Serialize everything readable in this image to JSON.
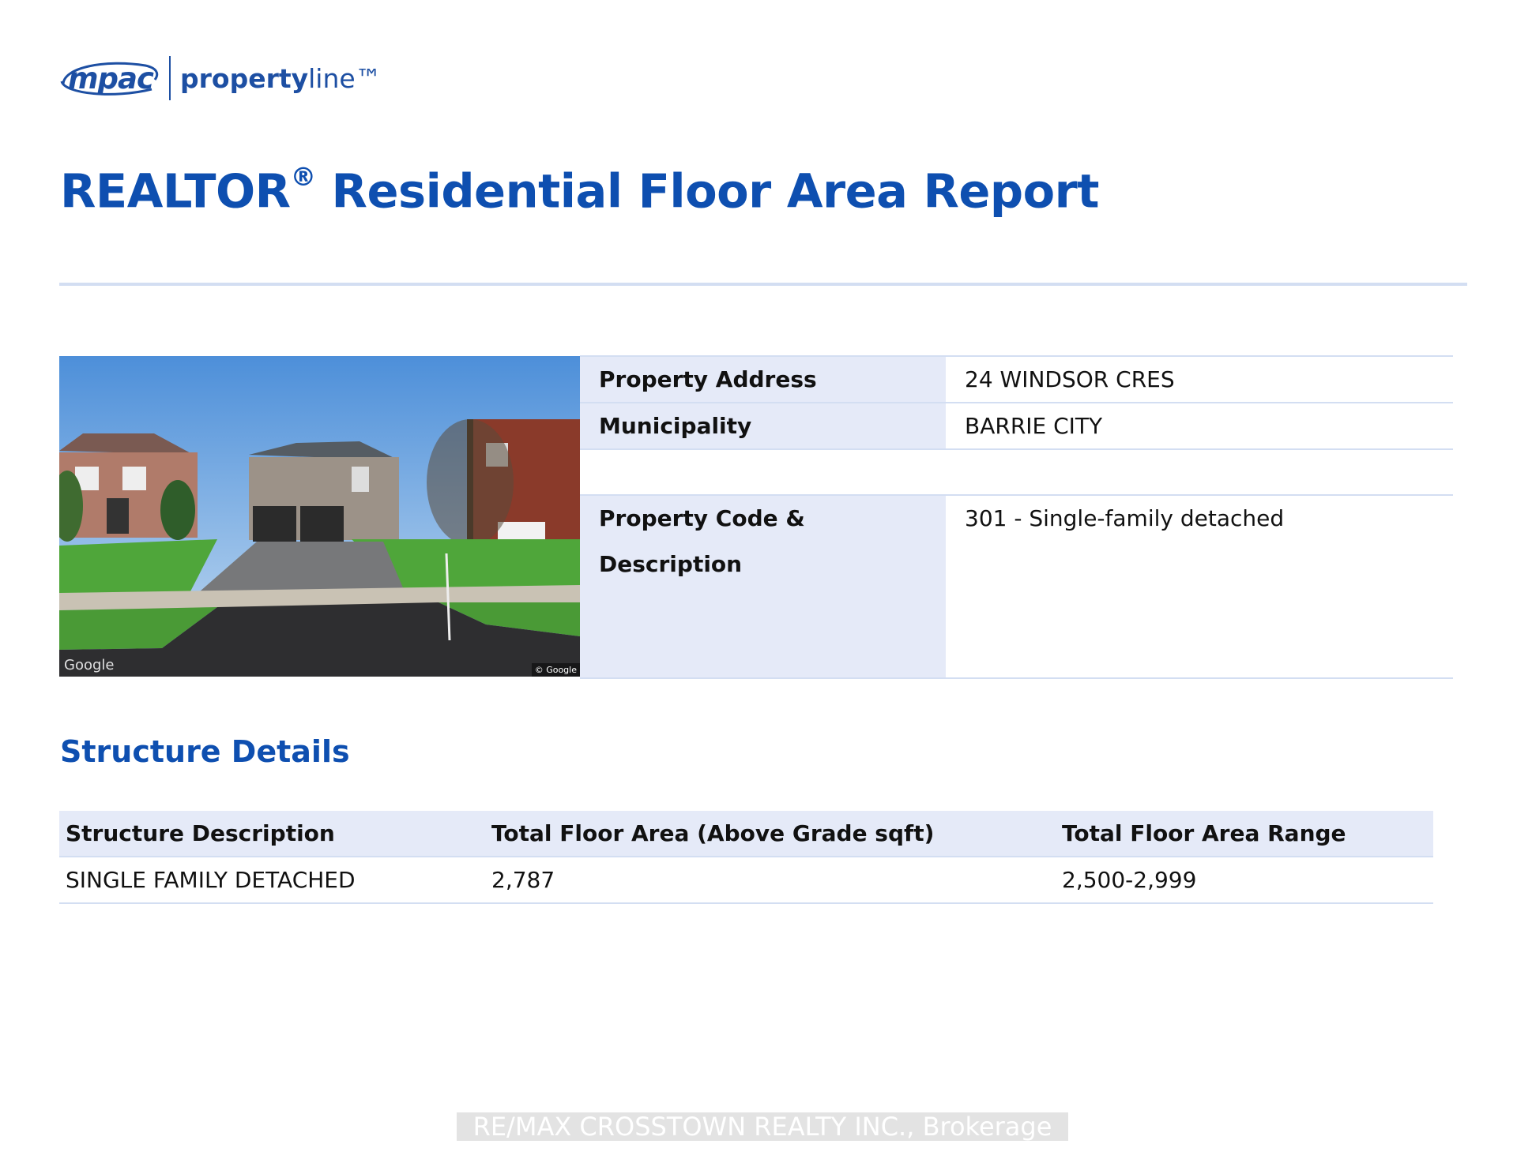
{
  "logo": {
    "mpac": "mpac",
    "brand_bold": "property",
    "brand_light": "line™"
  },
  "report": {
    "title": "REALTOR",
    "reg_mark": "®",
    "title_rest": " Residential Floor Area Report"
  },
  "photo": {
    "watermark_left": "Google",
    "watermark_right": "© Google"
  },
  "property": {
    "address_label": "Property Address",
    "address_value": "24 WINDSOR CRES",
    "municipality_label": "Municipality",
    "municipality_value": "BARRIE CITY",
    "code_label": "Property Code & Description",
    "code_value": "301 - Single-family detached"
  },
  "structure": {
    "heading": "Structure Details",
    "columns": [
      "Structure Description",
      "Total Floor Area (Above Grade sqft)",
      "Total Floor Area Range"
    ],
    "rows": [
      [
        "SINGLE FAMILY DETACHED",
        "2,787",
        "2,500-2,999"
      ]
    ]
  },
  "footer": {
    "text": "RE/MAX CROSSTOWN REALTY INC., Brokerage"
  },
  "colors": {
    "brand_blue": "#0e4fb0",
    "label_bg": "#e5eaf8",
    "rule": "#d3def2"
  }
}
